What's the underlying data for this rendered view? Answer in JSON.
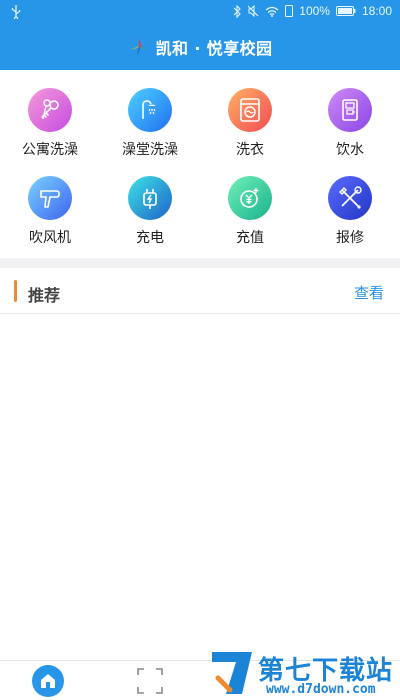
{
  "status_bar": {
    "battery": "100%",
    "time": "18:00"
  },
  "header": {
    "title": "凯和 · 悦享校园",
    "logo_icon": "kaihe-logo-icon"
  },
  "services": [
    {
      "label": "公寓洗澡",
      "icon": "key-icon",
      "colors": [
        "#f59ad9",
        "#c64be0"
      ]
    },
    {
      "label": "澡堂洗澡",
      "icon": "shower-icon",
      "colors": [
        "#4fd1ff",
        "#1f6ff0"
      ]
    },
    {
      "label": "洗衣",
      "icon": "washing-machine-icon",
      "colors": [
        "#ffb164",
        "#f24b54"
      ]
    },
    {
      "label": "饮水",
      "icon": "water-dispenser-icon",
      "colors": [
        "#cf8bf5",
        "#8a45e6"
      ]
    },
    {
      "label": "吹风机",
      "icon": "hair-dryer-icon",
      "colors": [
        "#7ad3ff",
        "#3d63f0"
      ]
    },
    {
      "label": "充电",
      "icon": "charging-plug-icon",
      "colors": [
        "#3ee3e6",
        "#1f62c8"
      ]
    },
    {
      "label": "充值",
      "icon": "recharge-wallet-icon",
      "colors": [
        "#6ff0b8",
        "#1ab28c"
      ]
    },
    {
      "label": "报修",
      "icon": "repair-tools-icon",
      "colors": [
        "#5a6cff",
        "#2235c4"
      ]
    }
  ],
  "recommend": {
    "title": "推荐",
    "link": "查看"
  },
  "watermark": {
    "title": "第七下载站",
    "subtitle": "www.d7down.com"
  }
}
